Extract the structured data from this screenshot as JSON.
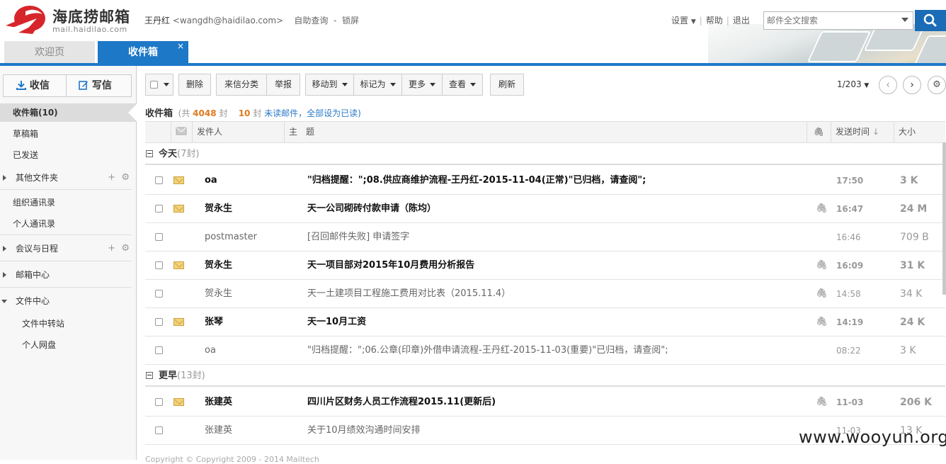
{
  "brand": {
    "name": "海底捞邮箱",
    "domain": "mail.haidilao.com"
  },
  "user": {
    "name": "王丹红",
    "email": "<wangdh@haidilao.com>",
    "self_service": "自助查询",
    "separator": "-",
    "lock": "锁屏"
  },
  "top_links": {
    "settings": "设置",
    "help": "帮助",
    "logout": "退出"
  },
  "search": {
    "placeholder": "邮件全文搜索"
  },
  "tabs": [
    {
      "label": "欢迎页"
    },
    {
      "label": "收件箱",
      "close": "×"
    }
  ],
  "sidebar": {
    "receive": "收信",
    "compose": "写信",
    "items": [
      {
        "label": "收件箱(10)"
      },
      {
        "label": "草稿箱"
      },
      {
        "label": "已发送"
      },
      {
        "label": "其他文件夹"
      },
      {
        "label": "组织通讯录"
      },
      {
        "label": "个人通讯录"
      },
      {
        "label": "会议与日程"
      },
      {
        "label": "邮箱中心"
      },
      {
        "label": "文件中心"
      },
      {
        "label": "文件中转站"
      },
      {
        "label": "个人网盘"
      }
    ]
  },
  "toolbar": {
    "delete": "删除",
    "classify": "来信分类",
    "report": "举报",
    "move": "移动到",
    "mark": "标记为",
    "more": "更多",
    "view": "查看",
    "refresh": "刷新"
  },
  "pager": {
    "page": "1/203"
  },
  "summary": {
    "folder": "收件箱",
    "total_prefix": "(共",
    "total": "4048",
    "total_suffix": "封",
    "unread_count": "10",
    "unread_suffix": "封",
    "unread_link": "未读邮件",
    "mark_all": "，全部设为已读)"
  },
  "columns": {
    "sender": "发件人",
    "subject": "主　题",
    "time": "发送时间",
    "size": "大小"
  },
  "groups": [
    {
      "label": "今天",
      "count": "(7封)"
    },
    {
      "label": "更早",
      "count": "(13封)"
    }
  ],
  "emails": [
    {
      "sender": "oa",
      "subject": "\"归档提醒：\";08.供应商维护流程-王丹红-2015-11-04(正常)\"已归档，请查阅\";",
      "time": "17:50",
      "size": "3 K",
      "unread": true,
      "attachment": false
    },
    {
      "sender": "贺永生",
      "subject": "天一公司砌砖付款申请（陈均）",
      "time": "16:47",
      "size": "24 M",
      "unread": true,
      "attachment": true
    },
    {
      "sender": "postmaster",
      "subject": "[召回邮件失败] 申请签字",
      "time": "16:46",
      "size": "709 B",
      "unread": false,
      "attachment": false
    },
    {
      "sender": "贺永生",
      "subject": "天一项目部对2015年10月费用分析报告",
      "time": "16:09",
      "size": "31 K",
      "unread": true,
      "attachment": true
    },
    {
      "sender": "贺永生",
      "subject": "天一土建项目工程施工费用对比表（2015.11.4）",
      "time": "14:58",
      "size": "34 K",
      "unread": false,
      "attachment": true
    },
    {
      "sender": "张琴",
      "subject": "天一10月工资",
      "time": "14:19",
      "size": "24 K",
      "unread": true,
      "attachment": true
    },
    {
      "sender": "oa",
      "subject": "\"归档提醒：\";06.公章(印章)外借申请流程-王丹红-2015-11-03(重要)\"已归档，请查阅\";",
      "time": "08:22",
      "size": "3 K",
      "unread": false,
      "attachment": false
    },
    {
      "sender": "张建英",
      "subject": "四川片区财务人员工作流程2015.11(更新后)",
      "time": "11-03",
      "size": "206 K",
      "unread": true,
      "attachment": true
    },
    {
      "sender": "张建英",
      "subject": "关于10月绩效沟通时间安排",
      "time": "11-03",
      "size": "13 K",
      "unread": false,
      "attachment": false
    }
  ],
  "footer": "Copyright © Copyright 2009 - 2014 Mailtech",
  "watermark": "www.wooyun.org",
  "colors": {
    "accent": "#1e78c8",
    "unread_count": "#e07a1f",
    "link": "#2a7ac7"
  }
}
